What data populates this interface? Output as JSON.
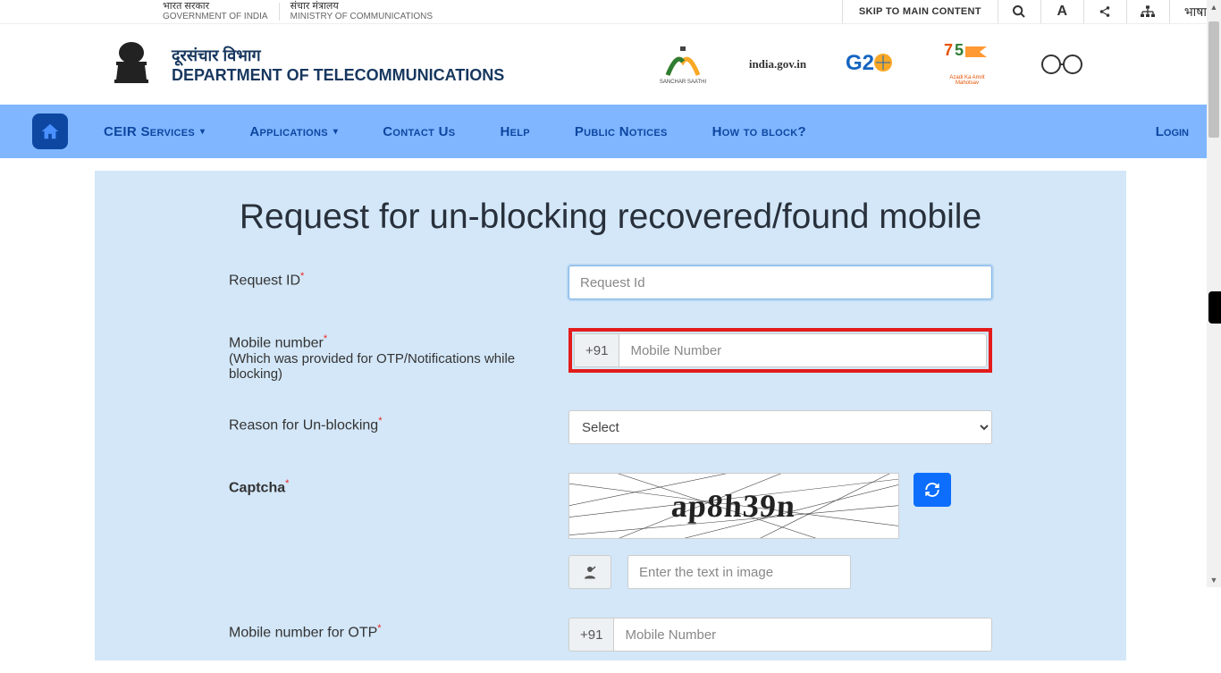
{
  "govbar": {
    "col1_hi": "भारत सरकार",
    "col1_en": "GOVERNMENT OF INDIA",
    "col2_hi": "संचार मंत्रालय",
    "col2_en": "MINISTRY OF COMMUNICATIONS",
    "skip": "SKIP TO MAIN CONTENT",
    "lang": "भाषा"
  },
  "header": {
    "title_hi": "दूरसंचार विभाग",
    "title_en": "DEPARTMENT OF TELECOMMUNICATIONS",
    "logos": {
      "sanchar": "SANCHAR SAATHI",
      "india": "india.gov.in",
      "g20": "G20",
      "azadi": "Azadi Ka Amrit Mahotsav",
      "gandhi": ""
    }
  },
  "nav": {
    "items": [
      "CEIR Services",
      "Applications",
      "Contact Us",
      "Help",
      "Public Notices",
      "How to block?"
    ],
    "login": "Login"
  },
  "form": {
    "title": "Request for un-blocking recovered/found mobile",
    "request_id_label": "Request ID",
    "request_id_placeholder": "Request Id",
    "mobile_label": "Mobile number",
    "mobile_sub": "(Which was provided for OTP/Notifications while blocking)",
    "mobile_prefix": "+91",
    "mobile_placeholder": "Mobile Number",
    "reason_label": "Reason for Un-blocking",
    "reason_placeholder": "Select",
    "captcha_label": "Captcha",
    "captcha_text": "ap8h39n",
    "captcha_input_placeholder": "Enter the text in image",
    "otp_mobile_label": "Mobile number for OTP",
    "otp_mobile_prefix": "+91",
    "otp_mobile_placeholder": "Mobile Number"
  }
}
